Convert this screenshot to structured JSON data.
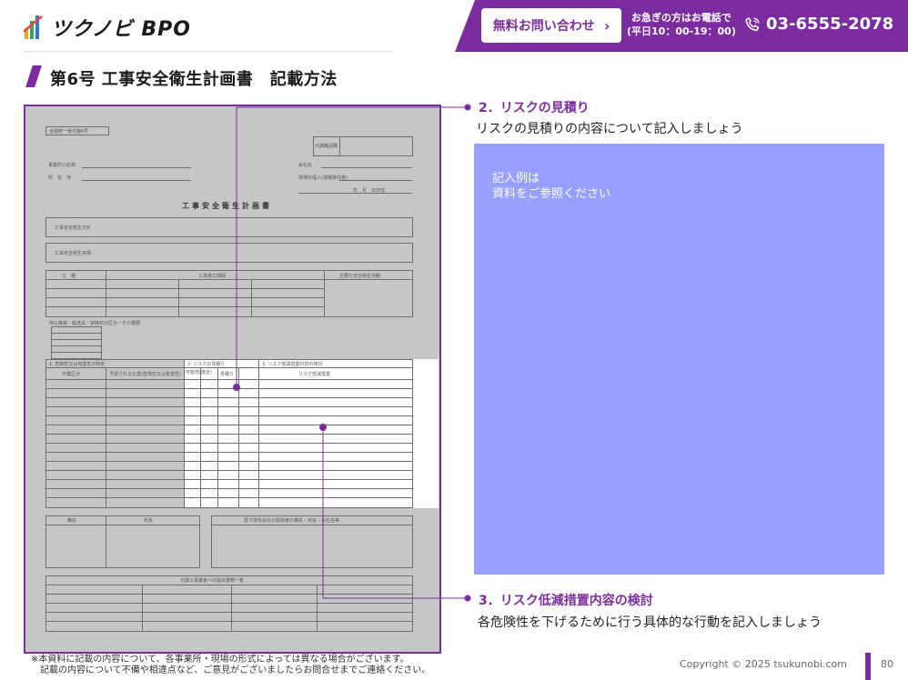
{
  "brand": {
    "logo_text": "ツクノビ BPO"
  },
  "header": {
    "contact_button_label": "無料お問い合わせ",
    "hours_line1": "お急ぎの方はお電話で",
    "hours_line2": "(平日10：00-19：00)",
    "phone": "03-6555-2078"
  },
  "page": {
    "title": "第6号 工事安全衛生計画書　記載方法"
  },
  "document": {
    "form_tag": "全建統一様式第6号",
    "title": "工事安全衛生計画書",
    "stamp_label": "元請確認欄",
    "field_office": "事業所の名称",
    "field_address": "所　在　地",
    "field_company": "会社名",
    "field_rep": "現場代理人(現場責任者)",
    "field_date": "年　月　日作成",
    "policy_label": "工事安全衛生方針",
    "goal_label": "工事安全衛生目標",
    "col_work": "工　種",
    "col_schedule": "工事施工期間",
    "col_safety": "主要な安全衛生活動",
    "machines_label": "持込機械・搬送具・資機材の区分／その種類",
    "hazards_label": "1. 危険性又は有害性の特定",
    "risk_estimate_label": "2. リスクの見積り",
    "risk_measure_label": "3. リスク低減措置内容の検討",
    "work_unit": "作業区分",
    "hazard_detail": "予測される災害(危険性又は有害性)",
    "possibility": "可能性(度合)",
    "severity": "重大性(重篤度)",
    "estimate": "見積り",
    "risk_level": "リスクレベル",
    "measure_detail": "リスク低減措置",
    "org_label": "職名",
    "org_name": "氏名",
    "sub_label": "再下請負会社の関係者の職名・氏名・会社名等",
    "submit_label": "元請工事業者への提出書類一覧"
  },
  "sections": {
    "risk_estimate": {
      "heading": "2．リスクの見積り",
      "description": "リスクの見積りの内容について記入しましょう"
    },
    "risk_reduction": {
      "heading": "3．リスク低減措置内容の検討",
      "description": "各危険性を下げるために行う具体的な行動を記入しましょう"
    }
  },
  "example_panel": {
    "line1": "記入例は",
    "line2": "資料をご参照ください"
  },
  "footer": {
    "note_line1": "※本資料に記載の内容について、各事業所・現場の形式によっては異なる場合がございます。",
    "note_line2": "記載の内容について不備や相違点など、ご意見がございましたらお問合せまでご連絡ください。",
    "copyright": "Copyright © 2025 tsukunobi.com",
    "page_number": "80"
  },
  "colors": {
    "accent": "#7b2d9f",
    "example_panel": "#96a0ff",
    "document_gray": "#c6c6c6"
  }
}
